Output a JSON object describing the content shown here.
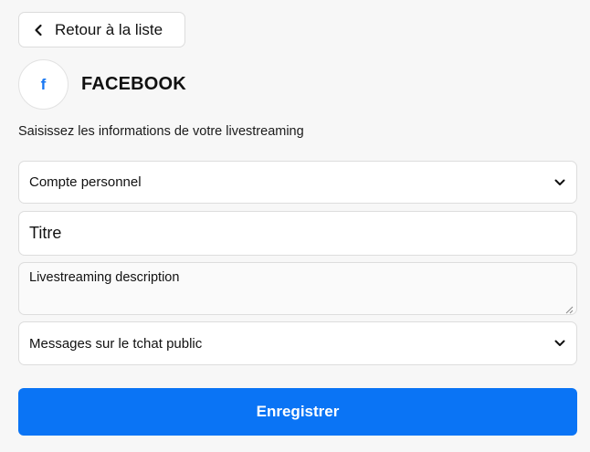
{
  "back_button": {
    "label": "Retour à la liste",
    "icon": "chevron-left-icon"
  },
  "platform": {
    "logo_letter": "f",
    "name": "FACEBOOK",
    "brand_color": "#1877f2"
  },
  "intro_text": "Saisissez les informations de votre livestreaming",
  "form": {
    "account_select": {
      "selected": "Compte personnel",
      "icon": "chevron-down-icon"
    },
    "title_input": {
      "value": "Titre"
    },
    "description_textarea": {
      "value": "Livestreaming description"
    },
    "chat_select": {
      "selected": "Messages sur le tchat public",
      "icon": "chevron-down-icon"
    }
  },
  "save_button": {
    "label": "Enregistrer",
    "color": "#0a74f5"
  }
}
